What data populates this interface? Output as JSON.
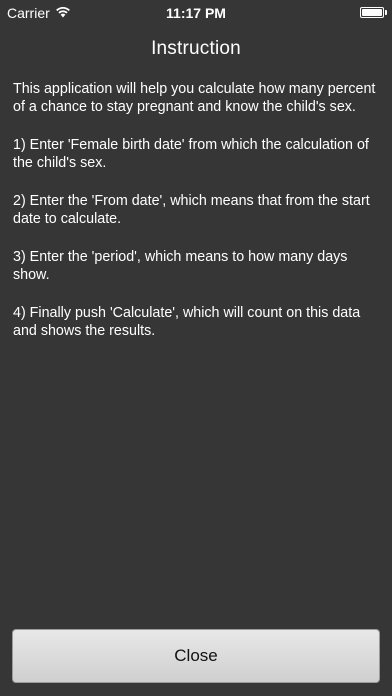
{
  "status_bar": {
    "carrier": "Carrier",
    "time": "11:17 PM",
    "wifi_icon": "wifi-icon",
    "battery_icon": "battery-icon"
  },
  "screen": {
    "title": "Instruction",
    "paragraphs": [
      "This application will help you calculate how many percent of a chance to stay pregnant and know the child's sex.",
      "1) Enter 'Female birth date' from which the calculation of the child's sex.",
      "2) Enter the 'From date', which means that from the start date to calculate.",
      "3) Enter the 'period', which means to how many days show.",
      "4) Finally push 'Calculate', which will count on this data and shows the results."
    ],
    "close_label": "Close"
  },
  "colors": {
    "background": "#363636",
    "text": "#ffffff",
    "button_bg": "#dcdcdc",
    "button_text": "#111111"
  }
}
